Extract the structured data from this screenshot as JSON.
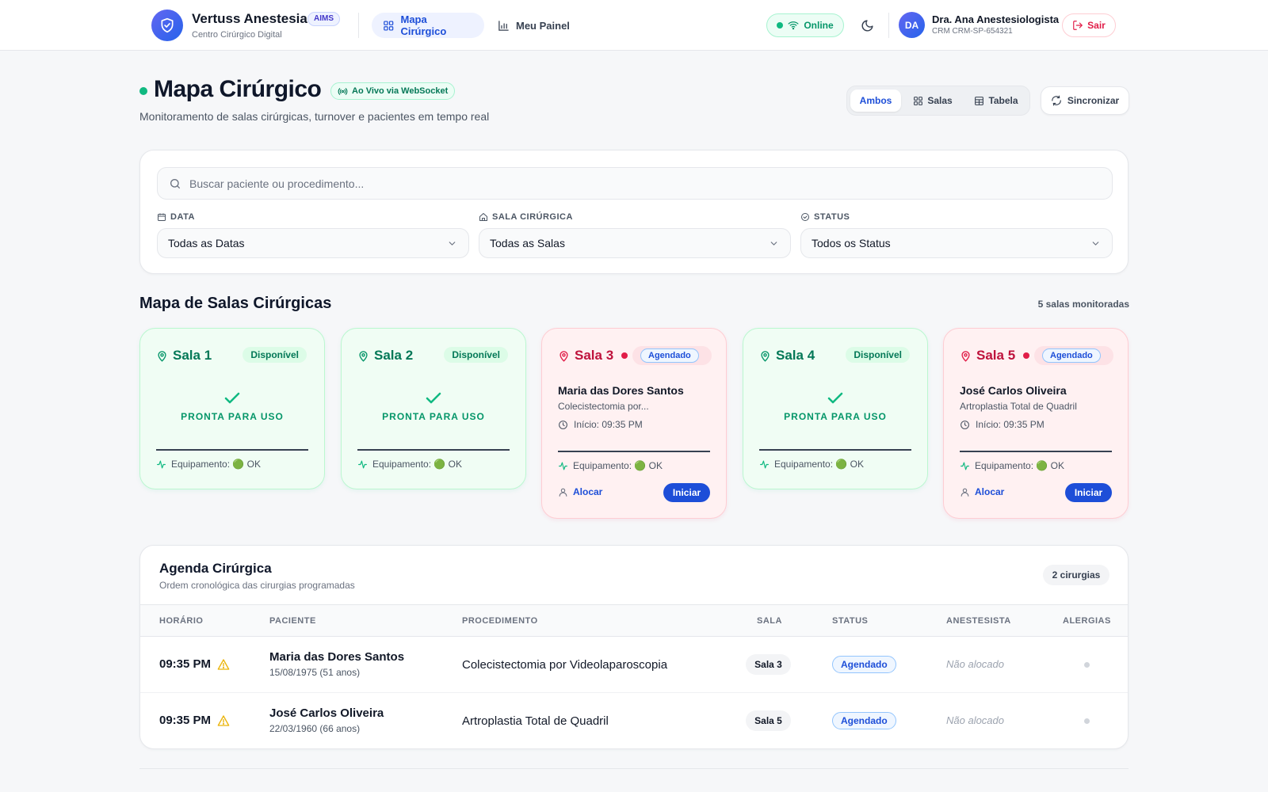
{
  "header": {
    "brand_title": "Vertuss Anestesia",
    "brand_badge": "AIMS",
    "brand_subtitle": "Centro Cirúrgico Digital",
    "nav": [
      {
        "label": "Mapa Cirúrgico",
        "icon": "grid-icon",
        "active": true
      },
      {
        "label": "Meu Painel",
        "icon": "bar-chart-icon",
        "active": false
      }
    ],
    "online_label": "Online",
    "user": {
      "initials": "DA",
      "name": "Dra. Ana Anestesiologista",
      "crm": "CRM CRM-SP-654321"
    },
    "logout_label": "Sair"
  },
  "page": {
    "title": "Mapa Cirúrgico",
    "live_badge": "Ao Vivo via WebSocket",
    "subtitle": "Monitoramento de salas cirúrgicas, turnover e pacientes em tempo real",
    "view_options": [
      {
        "label": "Ambos",
        "active": true
      },
      {
        "label": "Salas",
        "active": false
      },
      {
        "label": "Tabela",
        "active": false
      }
    ],
    "sync_label": "Sincronizar"
  },
  "filters": {
    "search_placeholder": "Buscar paciente ou procedimento...",
    "date": {
      "label": "DATA",
      "value": "Todas as Datas"
    },
    "room": {
      "label": "SALA CIRÚRGICA",
      "value": "Todas as Salas"
    },
    "status": {
      "label": "STATUS",
      "value": "Todos os Status"
    }
  },
  "rooms_section": {
    "title": "Mapa de Salas Cirúrgicas",
    "count": "5 salas monitoradas",
    "rooms": [
      {
        "name": "Sala 1",
        "status": "Disponível",
        "ready_label": "PRONTA PARA USO",
        "equipment": "Equipamento: 🟢 OK"
      },
      {
        "name": "Sala 2",
        "status": "Disponível",
        "ready_label": "PRONTA PARA USO",
        "equipment": "Equipamento: 🟢 OK"
      },
      {
        "name": "Sala 3",
        "status": "Agendado",
        "patient": "Maria das Dores Santos",
        "procedure": "Colecistectomia por...",
        "start": "Início: 09:35 PM",
        "equipment": "Equipamento: 🟢 OK",
        "allocate_label": "Alocar",
        "start_label": "Iniciar"
      },
      {
        "name": "Sala 4",
        "status": "Disponível",
        "ready_label": "PRONTA PARA USO",
        "equipment": "Equipamento: 🟢 OK"
      },
      {
        "name": "Sala 5",
        "status": "Agendado",
        "patient": "José Carlos Oliveira",
        "procedure": "Artroplastia Total de Quadril",
        "start": "Início: 09:35 PM",
        "equipment": "Equipamento: 🟢 OK",
        "allocate_label": "Alocar",
        "start_label": "Iniciar"
      }
    ]
  },
  "agenda": {
    "title": "Agenda Cirúrgica",
    "subtitle": "Ordem cronológica das cirurgias programadas",
    "count": "2 cirurgias",
    "columns": [
      "HORÁRIO",
      "PACIENTE",
      "PROCEDIMENTO",
      "SALA",
      "STATUS",
      "ANESTESISTA",
      "ALERGIAS"
    ],
    "rows": [
      {
        "time": "09:35 PM",
        "patient": "Maria das Dores Santos",
        "dob": "15/08/1975 (51 anos)",
        "procedure": "Colecistectomia por Videolaparoscopia",
        "room": "Sala 3",
        "status": "Agendado",
        "anesthetist": "Não alocado"
      },
      {
        "time": "09:35 PM",
        "patient": "José Carlos Oliveira",
        "dob": "22/03/1960 (66 anos)",
        "procedure": "Artroplastia Total de Quadril",
        "room": "Sala 5",
        "status": "Agendado",
        "anesthetist": "Não alocado"
      }
    ]
  },
  "colors": {
    "primary": "#1d4ed8",
    "available": "#059669",
    "scheduled": "#e11d48",
    "warning": "#eab308"
  }
}
